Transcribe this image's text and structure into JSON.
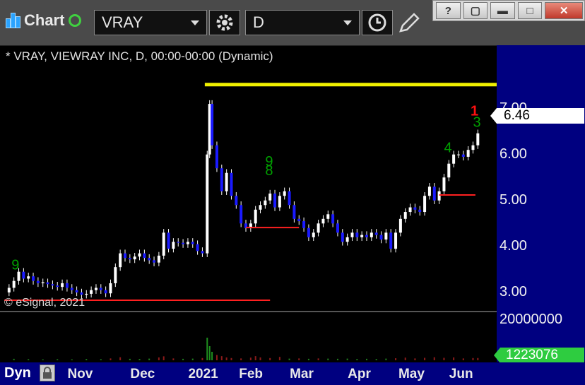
{
  "toolbar": {
    "chart_label": "Chart",
    "symbol_value": "VRAY",
    "interval_value": "D",
    "icons": [
      "chart-bars-icon",
      "status-dot-icon",
      "settings-gear-icon",
      "clock-icon",
      "pencil-icon"
    ]
  },
  "window_buttons": {
    "help": "?",
    "restore_down": "▢",
    "minimize": "▬",
    "maximize": "□",
    "close": "✕"
  },
  "chart_title": "* VRAY, VIEWRAY INC, D, 00:00-00:00 (Dynamic)",
  "copyright": "© eSignal, 2021",
  "last_price_label": "6.46",
  "last_volume_label": "1223076",
  "bottom": {
    "dyn_label": "Dyn"
  },
  "colors": {
    "up": "#ffffff",
    "down": "#1a1aff",
    "axis_bg": "#000080",
    "resistance": "#f0f000",
    "support": "#ff2020",
    "signal": "#00a000",
    "signal_red": "#ff1010"
  },
  "chart_data": {
    "type": "candlestick",
    "title": "",
    "price_axis_ticks": [
      "7.00",
      "6.00",
      "5.00",
      "4.00",
      "3.00"
    ],
    "price_ylim": [
      2.6,
      7.9
    ],
    "volume_axis_ticks": [
      "20000000"
    ],
    "volume_ylim": [
      0,
      24000000
    ],
    "month_labels": [
      "Nov",
      "Dec",
      "2021",
      "Feb",
      "Mar",
      "Apr",
      "May",
      "Jun"
    ],
    "x_range": [
      0,
      200
    ],
    "month_positions": [
      32,
      58,
      82,
      103,
      124,
      148,
      169,
      190
    ],
    "price_path": [
      [
        0,
        3.0
      ],
      [
        2,
        3.1
      ],
      [
        4,
        3.25
      ],
      [
        6,
        3.45
      ],
      [
        8,
        3.3
      ],
      [
        10,
        3.35
      ],
      [
        12,
        3.25
      ],
      [
        14,
        3.2
      ],
      [
        16,
        3.22
      ],
      [
        18,
        3.18
      ],
      [
        20,
        3.15
      ],
      [
        22,
        3.12
      ],
      [
        24,
        3.2
      ],
      [
        26,
        3.1
      ],
      [
        28,
        3.05
      ],
      [
        30,
        3.0
      ],
      [
        32,
        2.95
      ],
      [
        34,
        2.97
      ],
      [
        36,
        3.05
      ],
      [
        38,
        3.1
      ],
      [
        40,
        3.05
      ],
      [
        42,
        2.98
      ],
      [
        44,
        3.2
      ],
      [
        46,
        3.55
      ],
      [
        48,
        3.85
      ],
      [
        50,
        3.75
      ],
      [
        52,
        3.72
      ],
      [
        54,
        3.78
      ],
      [
        56,
        3.85
      ],
      [
        58,
        3.75
      ],
      [
        60,
        3.7
      ],
      [
        62,
        3.65
      ],
      [
        64,
        3.8
      ],
      [
        66,
        4.3
      ],
      [
        68,
        3.95
      ],
      [
        70,
        4.1
      ],
      [
        72,
        4.08
      ],
      [
        74,
        4.05
      ],
      [
        76,
        4.1
      ],
      [
        78,
        4.05
      ],
      [
        80,
        3.9
      ],
      [
        82,
        3.85
      ],
      [
        84,
        6.0
      ],
      [
        85,
        7.1
      ],
      [
        86,
        6.2
      ],
      [
        88,
        5.7
      ],
      [
        90,
        5.2
      ],
      [
        92,
        5.6
      ],
      [
        94,
        5.1
      ],
      [
        96,
        4.9
      ],
      [
        98,
        4.5
      ],
      [
        100,
        4.4
      ],
      [
        102,
        4.5
      ],
      [
        104,
        4.8
      ],
      [
        106,
        4.9
      ],
      [
        108,
        5.0
      ],
      [
        110,
        5.15
      ],
      [
        112,
        4.85
      ],
      [
        114,
        5.1
      ],
      [
        116,
        5.2
      ],
      [
        118,
        4.9
      ],
      [
        120,
        4.6
      ],
      [
        122,
        4.55
      ],
      [
        124,
        4.4
      ],
      [
        126,
        4.2
      ],
      [
        128,
        4.3
      ],
      [
        130,
        4.5
      ],
      [
        132,
        4.6
      ],
      [
        134,
        4.7
      ],
      [
        136,
        4.5
      ],
      [
        138,
        4.3
      ],
      [
        140,
        4.1
      ],
      [
        142,
        4.2
      ],
      [
        144,
        4.3
      ],
      [
        146,
        4.2
      ],
      [
        148,
        4.25
      ],
      [
        150,
        4.2
      ],
      [
        152,
        4.3
      ],
      [
        154,
        4.25
      ],
      [
        156,
        4.15
      ],
      [
        158,
        4.3
      ],
      [
        160,
        3.95
      ],
      [
        162,
        4.3
      ],
      [
        164,
        4.6
      ],
      [
        166,
        4.75
      ],
      [
        168,
        4.85
      ],
      [
        170,
        4.8
      ],
      [
        172,
        4.75
      ],
      [
        174,
        5.1
      ],
      [
        176,
        5.3
      ],
      [
        178,
        5.0
      ],
      [
        180,
        5.2
      ],
      [
        182,
        5.5
      ],
      [
        184,
        5.8
      ],
      [
        186,
        6.0
      ],
      [
        188,
        6.0
      ],
      [
        190,
        5.95
      ],
      [
        192,
        6.1
      ],
      [
        194,
        6.2
      ],
      [
        196,
        6.46
      ]
    ],
    "volume_bars": [
      [
        4,
        0.8
      ],
      [
        10,
        0.6
      ],
      [
        16,
        0.5
      ],
      [
        22,
        0.6
      ],
      [
        28,
        0.5
      ],
      [
        34,
        0.7
      ],
      [
        40,
        0.6
      ],
      [
        44,
        1.0
      ],
      [
        48,
        1.6
      ],
      [
        52,
        0.8
      ],
      [
        56,
        0.7
      ],
      [
        60,
        0.9
      ],
      [
        64,
        1.5
      ],
      [
        66,
        2.1
      ],
      [
        70,
        1.0
      ],
      [
        74,
        0.8
      ],
      [
        78,
        0.9
      ],
      [
        82,
        1.2
      ],
      [
        84,
        12.0
      ],
      [
        85,
        7.5
      ],
      [
        86,
        4.5
      ],
      [
        88,
        2.8
      ],
      [
        90,
        2.2
      ],
      [
        92,
        1.5
      ],
      [
        94,
        1.2
      ],
      [
        98,
        1.0
      ],
      [
        102,
        1.4
      ],
      [
        104,
        2.2
      ],
      [
        106,
        1.5
      ],
      [
        110,
        1.2
      ],
      [
        114,
        1.8
      ],
      [
        118,
        0.9
      ],
      [
        122,
        1.0
      ],
      [
        126,
        0.8
      ],
      [
        130,
        1.0
      ],
      [
        134,
        0.9
      ],
      [
        138,
        0.8
      ],
      [
        142,
        0.9
      ],
      [
        146,
        0.7
      ],
      [
        150,
        0.8
      ],
      [
        154,
        0.7
      ],
      [
        158,
        0.9
      ],
      [
        162,
        1.1
      ],
      [
        166,
        1.4
      ],
      [
        170,
        1.0
      ],
      [
        174,
        1.3
      ],
      [
        178,
        1.6
      ],
      [
        182,
        1.3
      ],
      [
        186,
        1.5
      ],
      [
        190,
        1.0
      ],
      [
        194,
        1.2
      ],
      [
        196,
        1.22
      ]
    ],
    "horizontal_lines": [
      {
        "color": "#f0f000",
        "price": 7.52,
        "from": 83,
        "to": 218
      },
      {
        "color": "#ff2020",
        "price": 2.83,
        "from": 0,
        "to": 110
      },
      {
        "color": "#ff2020",
        "price": 4.41,
        "from": 100,
        "to": 122
      },
      {
        "color": "#ff2020",
        "price": 5.12,
        "from": 180,
        "to": 195
      }
    ],
    "annotations": [
      {
        "text": "9",
        "x": 3,
        "price": 3.5,
        "color": "#00a000"
      },
      {
        "text": "9",
        "x": 108,
        "price": 5.75,
        "color": "#00a000"
      },
      {
        "text": "8",
        "x": 108,
        "price": 5.55,
        "color": "#00a000"
      },
      {
        "text": "4",
        "x": 182,
        "price": 6.05,
        "color": "#00a000"
      },
      {
        "text": "3",
        "x": 194,
        "price": 6.6,
        "color": "#00a000"
      },
      {
        "text": "1",
        "x": 193,
        "price": 6.85,
        "color": "#ff1010"
      }
    ]
  }
}
